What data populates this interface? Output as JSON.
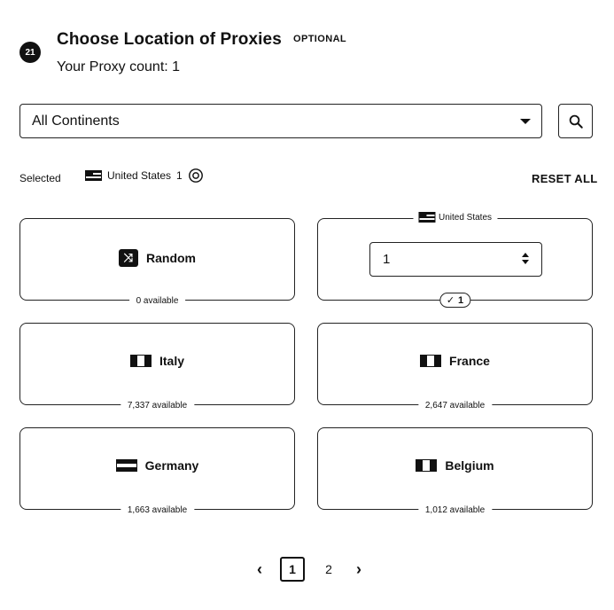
{
  "step_number": "21",
  "title": "Choose Location of Proxies",
  "optional_tag": "OPTIONAL",
  "proxy_count": "Your Proxy count: 1",
  "continent_select": {
    "value": "All Continents"
  },
  "selected_label": "Selected",
  "selected_chip": {
    "country": "United States",
    "count": "1"
  },
  "reset_label": "RESET ALL",
  "cards": {
    "random": {
      "label": "Random",
      "available": "0 available"
    },
    "united_states": {
      "label": "United States",
      "quantity": "1",
      "badge": "1"
    },
    "italy": {
      "label": "Italy",
      "available": "7,337 available"
    },
    "france": {
      "label": "France",
      "available": "2,647 available"
    },
    "germany": {
      "label": "Germany",
      "available": "1,663 available"
    },
    "belgium": {
      "label": "Belgium",
      "available": "1,012 available"
    }
  },
  "pagination": {
    "current": "1",
    "next_page": "2",
    "prev_symbol": "‹",
    "next_symbol": "›"
  },
  "icons": {
    "shuffle": "shuffle-icon",
    "search": "search-icon",
    "remove": "remove-circle-icon",
    "check": "check-icon"
  }
}
